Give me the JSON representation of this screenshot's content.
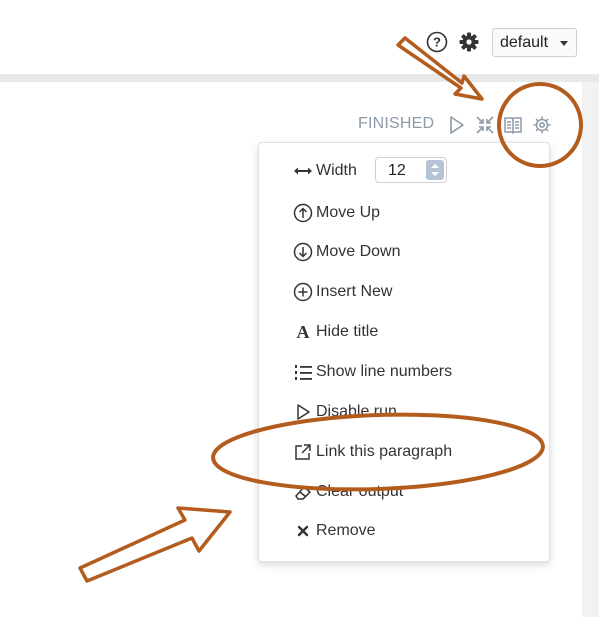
{
  "topbar": {
    "help_icon": "question-circle-icon",
    "settings_icon": "gear-icon",
    "interpreter_select": {
      "value": "default"
    }
  },
  "paragraph": {
    "status": "FINISHED",
    "toolbar_icons": [
      "play-icon",
      "collapse-icon",
      "book-icon",
      "settings-gear-icon"
    ]
  },
  "menu": {
    "width": {
      "label": "Width",
      "value": "12",
      "icon": "arrows-h-icon"
    },
    "items": [
      {
        "label": "Move Up",
        "icon": "arrow-circle-up-icon"
      },
      {
        "label": "Move Down",
        "icon": "arrow-circle-down-icon"
      },
      {
        "label": "Insert New",
        "icon": "plus-circle-icon"
      },
      {
        "label": "Hide title",
        "icon": "font-icon"
      },
      {
        "label": "Show line numbers",
        "icon": "list-ol-icon"
      },
      {
        "label": "Disable run",
        "icon": "play-outline-icon"
      },
      {
        "label": "Link this paragraph",
        "icon": "external-link-icon"
      },
      {
        "label": "Clear output",
        "icon": "eraser-icon"
      },
      {
        "label": "Remove",
        "icon": "times-icon"
      }
    ]
  },
  "colors": {
    "annotation": "#b35c1e",
    "status_text": "#8d9aa8",
    "spinner": "#b4c4d2"
  }
}
